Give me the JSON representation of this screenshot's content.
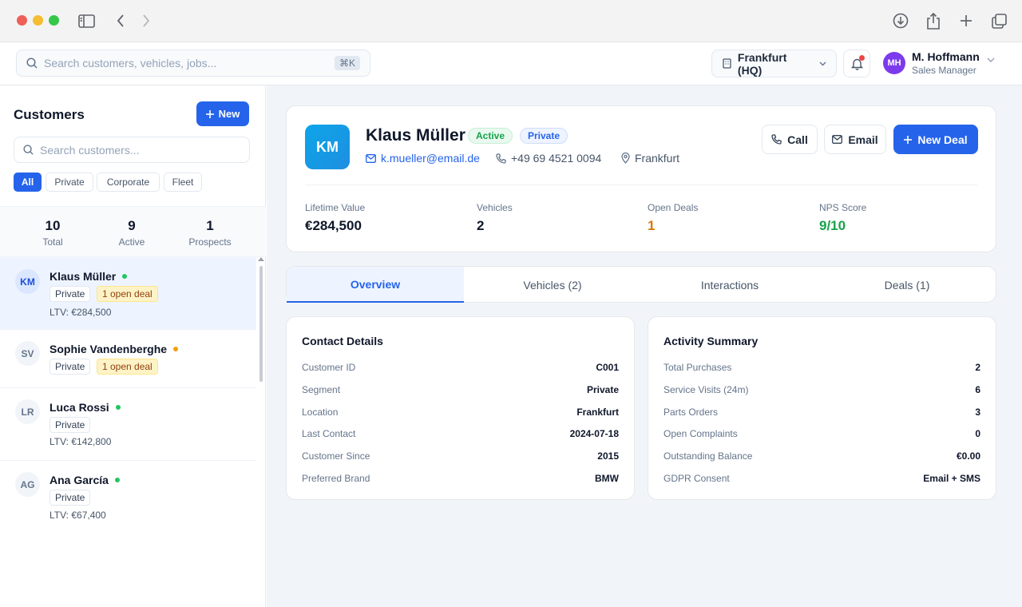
{
  "header": {
    "search_placeholder": "Search customers, vehicles, jobs...",
    "search_shortcut": "⌘K",
    "location": "Frankfurt (HQ)",
    "user": {
      "initials": "MH",
      "name": "M. Hoffmann",
      "role": "Sales Manager"
    }
  },
  "sidebar": {
    "title": "Customers",
    "new_label": "New",
    "search_placeholder": "Search customers...",
    "filters": [
      "All",
      "Private",
      "Corporate",
      "Fleet"
    ],
    "stats": [
      {
        "value": "10",
        "label": "Total"
      },
      {
        "value": "9",
        "label": "Active"
      },
      {
        "value": "1",
        "label": "Prospects"
      }
    ],
    "customers": [
      {
        "initials": "KM",
        "name": "Klaus Müller",
        "status_color": "#22c55e",
        "segment": "Private",
        "deal": "1 open deal",
        "ltv": "LTV: €284,500"
      },
      {
        "initials": "SV",
        "name": "Sophie Vandenberghe",
        "status_color": "#f59e0b",
        "segment": "Private",
        "deal": "1 open deal",
        "ltv": ""
      },
      {
        "initials": "LR",
        "name": "Luca Rossi",
        "status_color": "#22c55e",
        "segment": "Private",
        "deal": "",
        "ltv": "LTV: €142,800"
      },
      {
        "initials": "AG",
        "name": "Ana García",
        "status_color": "#22c55e",
        "segment": "Private",
        "deal": "",
        "ltv": "LTV: €67,400"
      }
    ]
  },
  "profile": {
    "initials": "KM",
    "name": "Klaus Müller",
    "status_badge": "Active",
    "segment_badge": "Private",
    "email": "k.mueller@email.de",
    "phone": "+49 69 4521 0094",
    "location": "Frankfurt",
    "actions": {
      "call": "Call",
      "email": "Email",
      "new_deal": "New Deal"
    },
    "kpis": [
      {
        "label": "Lifetime Value",
        "value": "€284,500",
        "color": "#0f172a"
      },
      {
        "label": "Vehicles",
        "value": "2",
        "color": "#0f172a"
      },
      {
        "label": "Open Deals",
        "value": "1",
        "color": "#d97706"
      },
      {
        "label": "NPS Score",
        "value": "9/10",
        "color": "#16a34a"
      }
    ]
  },
  "tabs": [
    "Overview",
    "Vehicles (2)",
    "Interactions",
    "Deals (1)"
  ],
  "contact_details": {
    "title": "Contact Details",
    "rows": [
      {
        "key": "Customer ID",
        "value": "C001"
      },
      {
        "key": "Segment",
        "value": "Private"
      },
      {
        "key": "Location",
        "value": "Frankfurt"
      },
      {
        "key": "Last Contact",
        "value": "2024-07-18"
      },
      {
        "key": "Customer Since",
        "value": "2015"
      },
      {
        "key": "Preferred Brand",
        "value": "BMW"
      }
    ]
  },
  "activity_summary": {
    "title": "Activity Summary",
    "rows": [
      {
        "key": "Total Purchases",
        "value": "2"
      },
      {
        "key": "Service Visits (24m)",
        "value": "6"
      },
      {
        "key": "Parts Orders",
        "value": "3"
      },
      {
        "key": "Open Complaints",
        "value": "0"
      },
      {
        "key": "Outstanding Balance",
        "value": "€0.00"
      },
      {
        "key": "GDPR Consent",
        "value": "Email + SMS"
      }
    ]
  }
}
